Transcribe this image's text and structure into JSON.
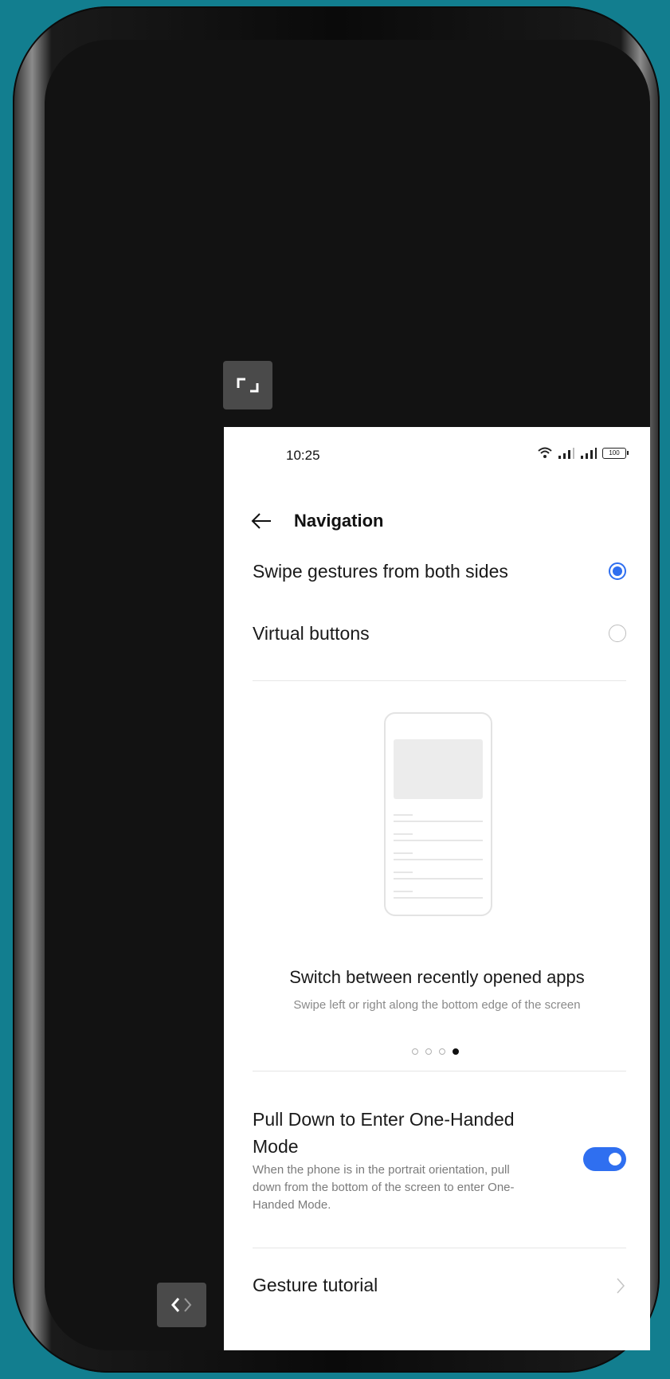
{
  "status": {
    "time": "10:25",
    "battery": "100"
  },
  "header": {
    "title": "Navigation"
  },
  "options": [
    {
      "label": "Swipe gestures from both sides",
      "selected": true
    },
    {
      "label": "Virtual buttons",
      "selected": false
    }
  ],
  "carousel": {
    "title": "Switch between recently opened apps",
    "description": "Swipe left or right along the bottom edge of the screen",
    "page_count": 4,
    "active_page": 4
  },
  "one_handed": {
    "title": "Pull Down to Enter One-Handed Mode",
    "description": "When the phone is in the portrait orientation, pull down from the bottom of the screen to enter One-Handed Mode.",
    "enabled": true
  },
  "tutorial": {
    "label": "Gesture tutorial"
  },
  "colors": {
    "accent": "#2f6ff0",
    "background": "#127e8f"
  },
  "icons": {
    "back": "arrow-left-icon",
    "expand": "expand-corners-icon",
    "nav": "chevron-left-right-icon",
    "wifi": "wifi-icon",
    "signal": "cellular-signal-icon",
    "battery": "battery-icon",
    "chevron": "chevron-right-icon"
  }
}
